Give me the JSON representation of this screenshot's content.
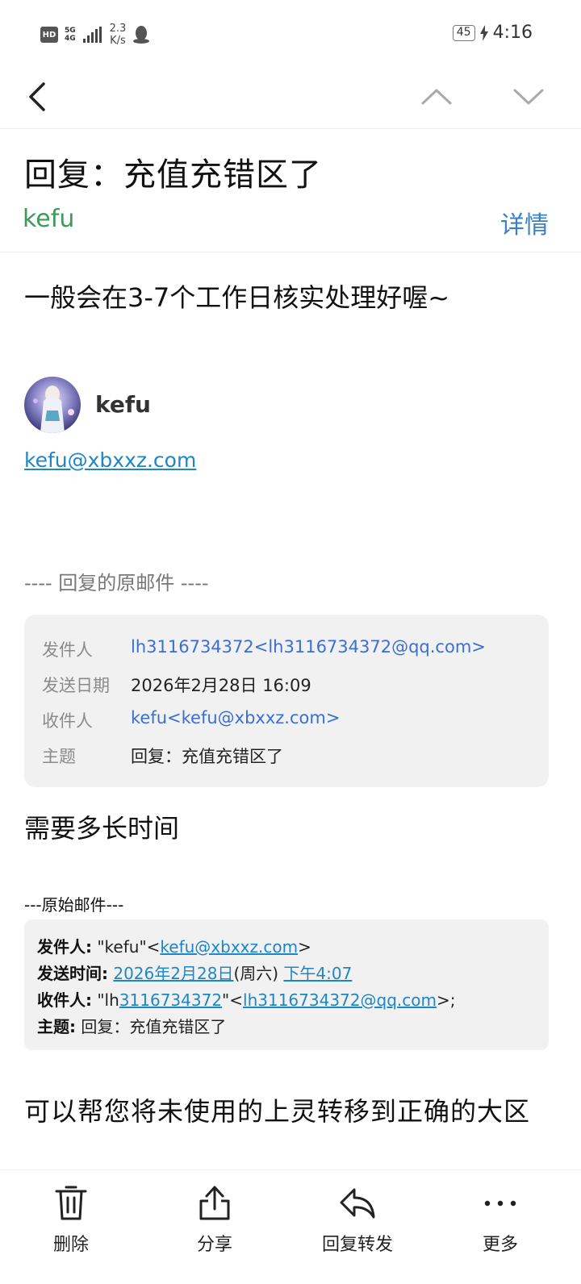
{
  "status_bar": {
    "hd": "HD",
    "network_top": "5G",
    "network_bottom": "4G",
    "speed_value": "2.3",
    "speed_unit": "K/s",
    "battery": "45",
    "time": "4:16"
  },
  "email": {
    "subject": "回复：充值充错区了",
    "sender": "kefu",
    "details_label": "详情",
    "body_line1": "一般会在3-7个工作日核实处理好喔~",
    "signature": {
      "name": "kefu",
      "email": "kefu@xbxxz.com"
    },
    "quote_separator": "---- 回复的原邮件 ----",
    "quoted_header": {
      "from_label": "发件人",
      "from_value": "lh3116734372<lh3116734372@qq.com>",
      "date_label": "发送日期",
      "date_value": "2026年2月28日 16:09",
      "to_label": "收件人",
      "to_value": "kefu<kefu@xbxxz.com>",
      "subject_label": "主题",
      "subject_value": "回复：充值充错区了"
    },
    "body_line2": "需要多长时间",
    "original_separator": "---原始邮件---",
    "original": {
      "from_label": "发件人:",
      "from_name": " \"kefu\"<",
      "from_email": "kefu@xbxxz.com",
      "from_close": ">",
      "sent_label": "发送时间:",
      "sent_date": "2026年2月28日",
      "sent_weekday": "(周六)",
      "sent_time": "下午4:07",
      "to_label": "收件人:",
      "to_prefix": " \"lh",
      "to_number": "3116734372",
      "to_mid": "\"<",
      "to_email": "lh3116734372@qq.com",
      "to_close": ">;",
      "subject_label": "主题:",
      "subject_value": " 回复：充值充错区了"
    },
    "body_line3": "可以帮您将未使用的上灵转移到正确的大区"
  },
  "toolbar": {
    "delete_label": "删除",
    "share_label": "分享",
    "reply_forward_label": "回复转发",
    "more_label": "更多"
  }
}
